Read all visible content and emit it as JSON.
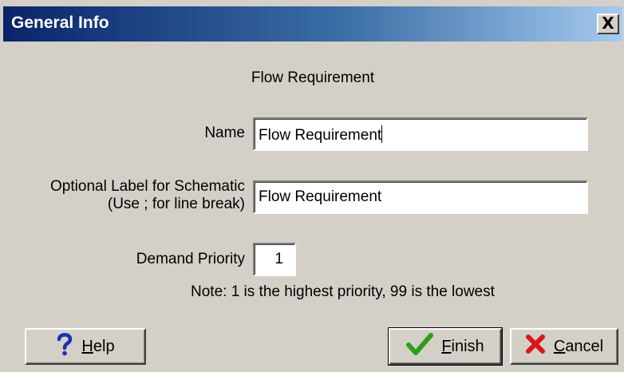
{
  "window": {
    "title": "General Info",
    "close_glyph": "X"
  },
  "section_title": "Flow Requirement",
  "fields": {
    "name": {
      "label": "Name",
      "value": "Flow Requirement"
    },
    "schematic_label": {
      "label_line1": "Optional Label for Schematic",
      "label_line2": "(Use ; for line break)",
      "value": "Flow Requirement"
    },
    "demand_priority": {
      "label": "Demand Priority",
      "value": "1"
    }
  },
  "note": "Note: 1 is the highest priority, 99 is the lowest",
  "buttons": {
    "help": {
      "mnemonic": "H",
      "rest": "elp",
      "icon": "question-mark-icon"
    },
    "finish": {
      "mnemonic": "F",
      "rest": "inish",
      "icon": "checkmark-icon"
    },
    "cancel": {
      "mnemonic": "C",
      "rest": "ancel",
      "icon": "red-x-icon"
    }
  },
  "colors": {
    "title_gradient_start": "#0a246a",
    "title_gradient_end": "#a6caf0",
    "face": "#d4d0c8",
    "help_icon": "#1a2fb8",
    "finish_icon": "#2e9e1c",
    "cancel_icon": "#d81818"
  }
}
